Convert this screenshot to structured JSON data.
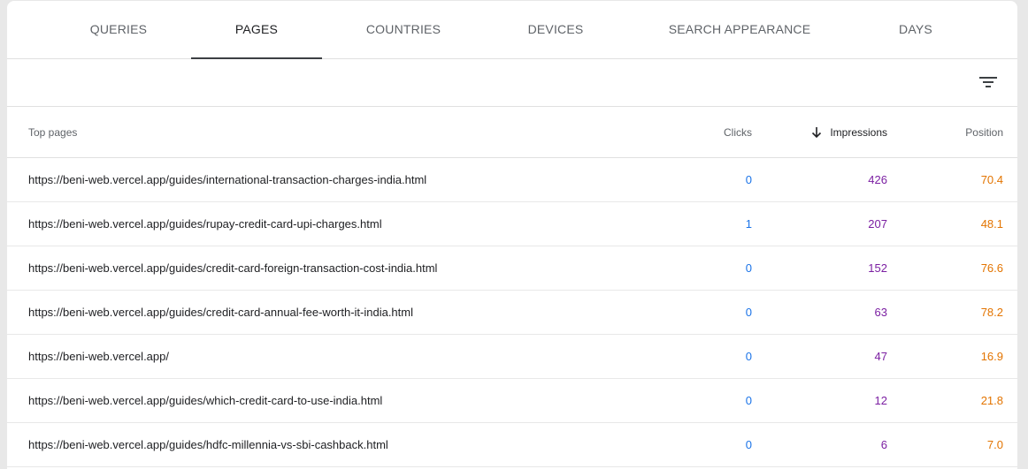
{
  "tabs": [
    {
      "label": "QUERIES",
      "active": false
    },
    {
      "label": "PAGES",
      "active": true
    },
    {
      "label": "COUNTRIES",
      "active": false
    },
    {
      "label": "DEVICES",
      "active": false
    },
    {
      "label": "SEARCH APPEARANCE",
      "active": false
    },
    {
      "label": "DAYS",
      "active": false
    }
  ],
  "toolbar": {
    "filter_icon": "filter-list-icon"
  },
  "table": {
    "headers": {
      "page": "Top pages",
      "clicks": "Clicks",
      "impressions": "Impressions",
      "position": "Position",
      "sort_icon": "arrow-down-icon"
    },
    "rows": [
      {
        "page": "https://beni-web.vercel.app/guides/international-transaction-charges-india.html",
        "clicks": "0",
        "impressions": "426",
        "position": "70.4"
      },
      {
        "page": "https://beni-web.vercel.app/guides/rupay-credit-card-upi-charges.html",
        "clicks": "1",
        "impressions": "207",
        "position": "48.1"
      },
      {
        "page": "https://beni-web.vercel.app/guides/credit-card-foreign-transaction-cost-india.html",
        "clicks": "0",
        "impressions": "152",
        "position": "76.6"
      },
      {
        "page": "https://beni-web.vercel.app/guides/credit-card-annual-fee-worth-it-india.html",
        "clicks": "0",
        "impressions": "63",
        "position": "78.2"
      },
      {
        "page": "https://beni-web.vercel.app/",
        "clicks": "0",
        "impressions": "47",
        "position": "16.9"
      },
      {
        "page": "https://beni-web.vercel.app/guides/which-credit-card-to-use-india.html",
        "clicks": "0",
        "impressions": "12",
        "position": "21.8"
      },
      {
        "page": "https://beni-web.vercel.app/guides/hdfc-millennia-vs-sbi-cashback.html",
        "clicks": "0",
        "impressions": "6",
        "position": "7.0"
      }
    ]
  },
  "colors": {
    "clicks": "#1a73e8",
    "impressions": "#7b1fa2",
    "position": "#e37400"
  }
}
